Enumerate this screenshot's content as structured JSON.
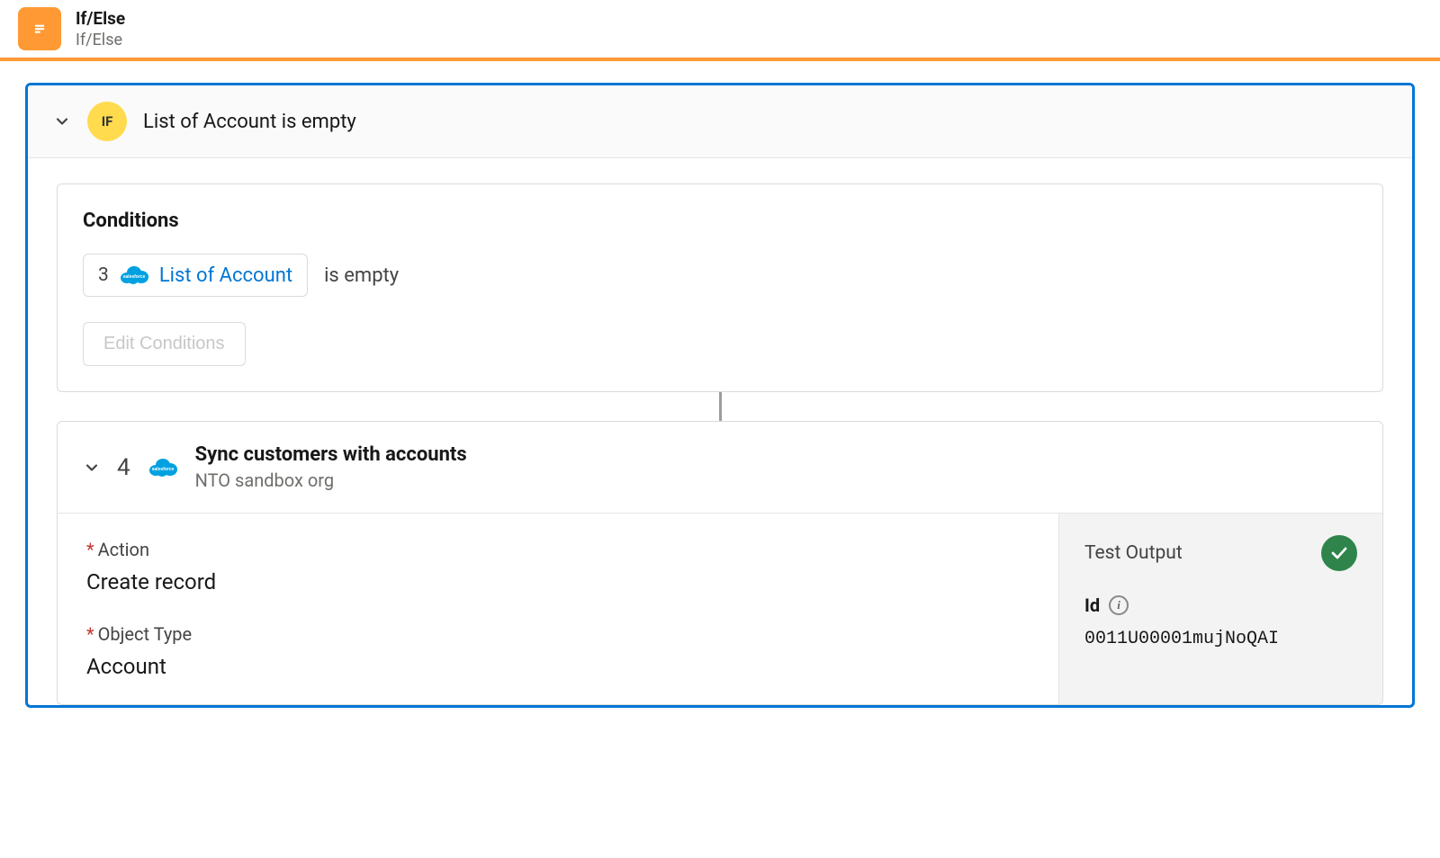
{
  "header": {
    "title": "If/Else",
    "subtitle": "If/Else"
  },
  "ifBlock": {
    "badge": "IF",
    "title": "List of Account is empty"
  },
  "conditions": {
    "label": "Conditions",
    "item": {
      "number": "3",
      "pillLabel": "List of Account",
      "operator": "is empty"
    },
    "editButton": "Edit Conditions"
  },
  "step": {
    "number": "4",
    "title": "Sync customers with accounts",
    "subtitle": "NTO sandbox org",
    "fields": {
      "actionLabel": "Action",
      "actionValue": "Create record",
      "objectTypeLabel": "Object Type",
      "objectTypeValue": "Account"
    }
  },
  "testOutput": {
    "title": "Test Output",
    "idLabel": "Id",
    "idValue": "0011U00001mujNoQAI"
  }
}
